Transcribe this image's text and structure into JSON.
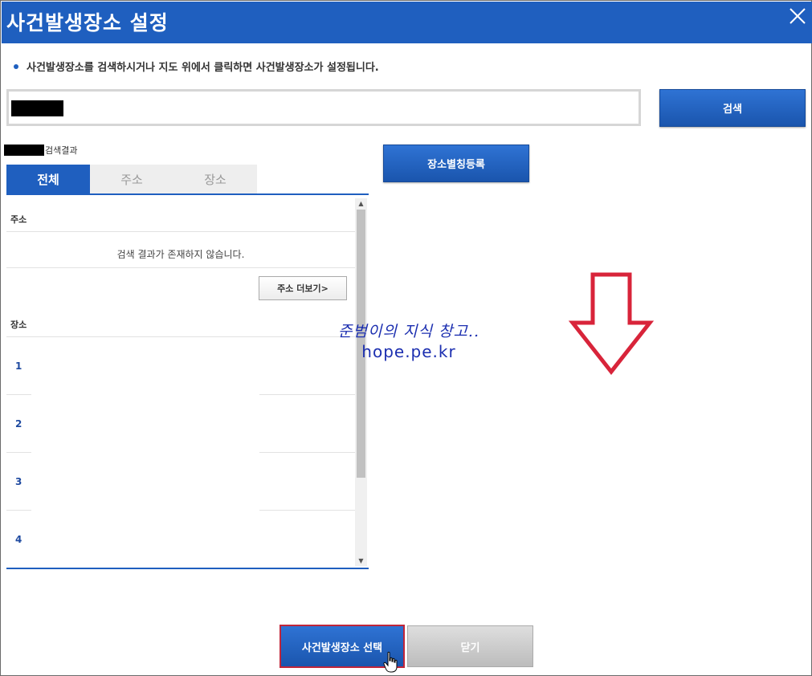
{
  "window": {
    "title": "사건발생장소 설정"
  },
  "notice": {
    "text": "사건발생장소를 검색하시거나 지도 위에서 클릭하면 사건발생장소가 설정됩니다."
  },
  "search": {
    "value": "",
    "button_label": "검색"
  },
  "alias_button_label": "장소별칭등록",
  "results": {
    "header_suffix": "검색결과",
    "tabs": [
      {
        "label": "전체",
        "active": true
      },
      {
        "label": "주소",
        "active": false
      },
      {
        "label": "장소",
        "active": false
      }
    ],
    "address_section_label": "주소",
    "empty_message": "검색 결과가 존재하지 않습니다.",
    "more_button_label": "주소 더보기>",
    "place_section_label": "장소",
    "place_rows": [
      "1",
      "2",
      "3",
      "4"
    ]
  },
  "watermark": {
    "line1": "준범이의 지식 창고..",
    "line2": "hope.pe.kr"
  },
  "footer": {
    "select_button_label": "사건발생장소 선택",
    "close_button_label": "닫기"
  },
  "colors": {
    "primary": "#1f5fbf",
    "arrow": "#d8243a",
    "watermark": "#1c2fb0",
    "highlight_border": "#c0263a"
  }
}
